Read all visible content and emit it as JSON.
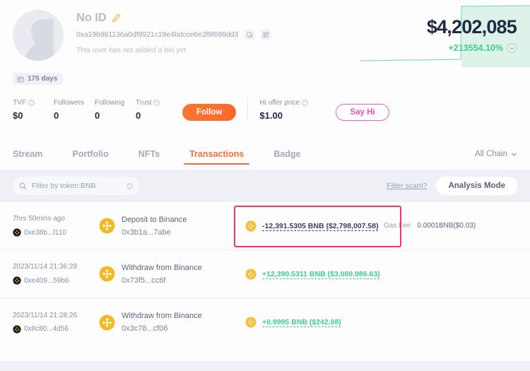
{
  "profile": {
    "name": "No ID",
    "edit_icon": "pencil-icon",
    "address": "0xa19b981136a0df9921c19e4bdcce6e2f9f699dd3",
    "copy_icon": "copy-icon",
    "qr_icon": "qr-code-icon",
    "bio": "This user has not added a bio yet",
    "avatar_icon": "user-avatar-placeholder",
    "days_badge": {
      "icon": "calendar-icon",
      "label": "175 days"
    }
  },
  "balance": {
    "amount": "$4,202,085",
    "change": "+213554.10%",
    "change_color": "#3ecf8e",
    "expand_icon": "chevron-down-icon"
  },
  "stats": [
    {
      "label": "TVF",
      "has_info": true,
      "value": "$0"
    },
    {
      "label": "Followers",
      "has_info": false,
      "value": "0"
    },
    {
      "label": "Following",
      "has_info": false,
      "value": "0"
    },
    {
      "label": "Trust",
      "has_info": true,
      "value": "0"
    }
  ],
  "actions": {
    "follow_label": "Follow",
    "follow_color": "#fb7532",
    "offer_label": "Hi offer price",
    "offer_value": "$1.00",
    "sayhi_label": "Say Hi",
    "sayhi_color": "#ef4bbd"
  },
  "tabs": [
    {
      "label": "Stream",
      "active": false
    },
    {
      "label": "Portfolio",
      "active": false
    },
    {
      "label": "NFTs",
      "active": false
    },
    {
      "label": "Transactions",
      "active": true
    },
    {
      "label": "Badge",
      "active": false
    }
  ],
  "tabs_accent": "#f4703a",
  "chain_filter": {
    "label": "All Chain",
    "icon": "chevron-down-icon"
  },
  "search": {
    "icon": "search-icon",
    "value": "Filter by token:BNB",
    "placeholder": "Filter by token",
    "clear_icon": "close-circle-icon"
  },
  "toolbar": {
    "scam_link": "Filter scam?",
    "analysis_label": "Analysis Mode"
  },
  "transactions": [
    {
      "time": "7hrs 50mins ago",
      "chain_icon": "bnb-chain-badge-icon",
      "tx_hash": "0xe38b...f110",
      "token_icon": "bnb-token-icon",
      "action": "Deposit to Binance",
      "counterparty": "0x3b1a...7abe",
      "amount_icon": "bnb-token-icon",
      "amount": "-12,391.5305 BNB ($2,798,007.58)",
      "amount_sign": "negative",
      "gas_label": "Gas Fee",
      "gas_value": "0.0001BNB($0.03)",
      "highlighted": true
    },
    {
      "time": "2023/11/14 21:36:29",
      "chain_icon": "bnb-chain-badge-icon",
      "tx_hash": "0xe409...59b6",
      "token_icon": "bnb-token-icon",
      "action": "Withdraw from Binance",
      "counterparty": "0x73f5...cc6f",
      "amount_icon": "bnb-token-icon",
      "amount": "+12,390.5311 BNB ($3,000,986.63)",
      "amount_sign": "positive",
      "gas_label": "",
      "gas_value": "",
      "highlighted": false
    },
    {
      "time": "2023/11/14 21:28:26",
      "chain_icon": "bnb-chain-badge-icon",
      "tx_hash": "0x8c80...4d56",
      "token_icon": "bnb-token-icon",
      "action": "Withdraw from Binance",
      "counterparty": "0x3c78...cf06",
      "amount_icon": "bnb-token-icon",
      "amount": "+0.9995 BNB ($242.08)",
      "amount_sign": "positive",
      "gas_label": "",
      "gas_value": "",
      "highlighted": false
    }
  ],
  "highlight_color": "#ec3b5c"
}
